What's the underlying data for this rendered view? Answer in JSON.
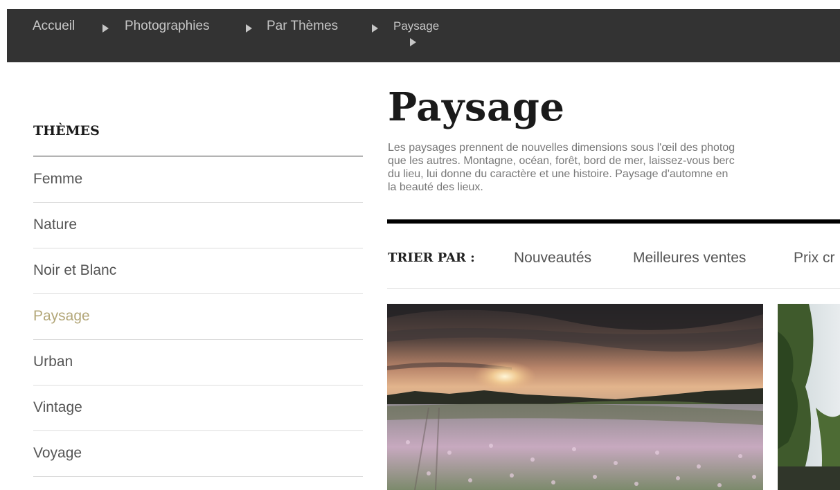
{
  "breadcrumb": {
    "items": [
      "Accueil",
      "Photographies",
      "Par Thèmes",
      "Paysage"
    ]
  },
  "sidebar": {
    "title": "THÈMES",
    "items": [
      {
        "label": "Femme",
        "active": false
      },
      {
        "label": "Nature",
        "active": false
      },
      {
        "label": "Noir et Blanc",
        "active": false
      },
      {
        "label": "Paysage",
        "active": true
      },
      {
        "label": "Urban",
        "active": false
      },
      {
        "label": "Vintage",
        "active": false
      },
      {
        "label": "Voyage",
        "active": false
      }
    ]
  },
  "main": {
    "title": "Paysage",
    "description_lines": [
      "Les paysages prennent de nouvelles dimensions sous l'œil des photog",
      "que les autres. Montagne, océan, forêt, bord de mer, laissez-vous berc",
      "du lieu, lui donne du caractère et une histoire. Paysage d'automne en",
      "la beauté des lieux."
    ],
    "sort": {
      "label": "TRIER PAR :",
      "options": [
        "Nouveautés",
        "Meilleures ventes",
        "Prix cr"
      ]
    }
  },
  "colors": {
    "breadcrumb_bg": "#333333",
    "active_item": "#b3a779",
    "text_gray": "#555555"
  },
  "icons": {
    "breadcrumb_separator": "caret-right-icon"
  }
}
